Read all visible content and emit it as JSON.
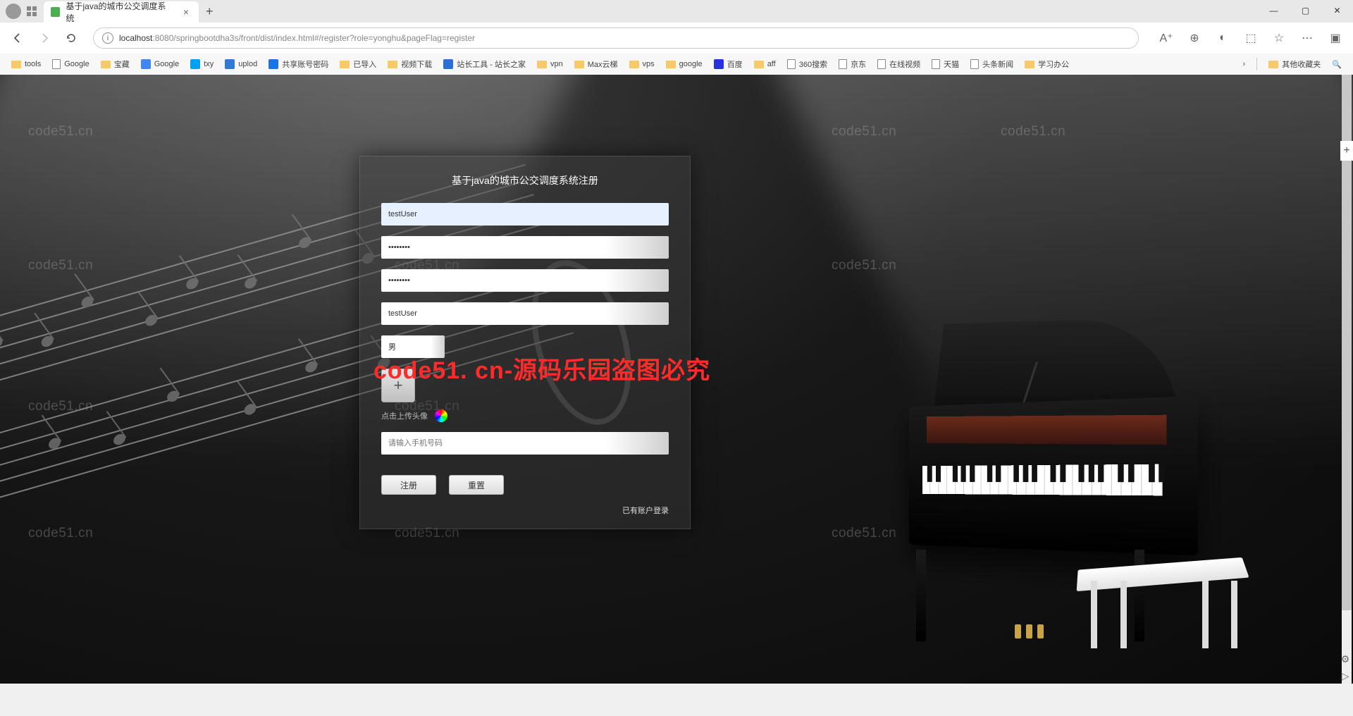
{
  "browser": {
    "tab_title": "基于java的城市公交调度系统",
    "url_host": "localhost",
    "url_path": ":8080/springbootdha3s/front/dist/index.html#/register?role=yonghu&pageFlag=register"
  },
  "bookmarks": {
    "items": [
      {
        "label": "tools",
        "type": "folder"
      },
      {
        "label": "Google",
        "type": "page"
      },
      {
        "label": "宝藏",
        "type": "folder"
      },
      {
        "label": "Google",
        "type": "icon",
        "color": "#4285f4"
      },
      {
        "label": "txy",
        "type": "icon",
        "color": "#00a1f1"
      },
      {
        "label": "uplod",
        "type": "icon",
        "color": "#2e7bd6"
      },
      {
        "label": "共享账号密码",
        "type": "icon",
        "color": "#1a73e8"
      },
      {
        "label": "已导入",
        "type": "folder"
      },
      {
        "label": "视频下载",
        "type": "folder"
      },
      {
        "label": "站长工具 - 站长之家",
        "type": "icon",
        "color": "#2a6fd6"
      },
      {
        "label": "vpn",
        "type": "folder"
      },
      {
        "label": "Max云梯",
        "type": "folder"
      },
      {
        "label": "vps",
        "type": "folder"
      },
      {
        "label": "google",
        "type": "folder"
      },
      {
        "label": "百度",
        "type": "icon",
        "color": "#2932e1"
      },
      {
        "label": "aff",
        "type": "folder"
      },
      {
        "label": "360搜索",
        "type": "page"
      },
      {
        "label": "京东",
        "type": "page"
      },
      {
        "label": "在线视频",
        "type": "page"
      },
      {
        "label": "天猫",
        "type": "page"
      },
      {
        "label": "头条新闻",
        "type": "page"
      },
      {
        "label": "学习办公",
        "type": "folder"
      }
    ],
    "other": "其他收藏夹"
  },
  "form": {
    "title": "基于java的城市公交调度系统注册",
    "username_value": "testUser",
    "password_value": "••••••••",
    "confirm_value": "••••••••",
    "nickname_value": "testUser",
    "gender_value": "男",
    "upload_hint": "点击上传头像",
    "phone_placeholder": "请输入手机号码",
    "register_btn": "注册",
    "reset_btn": "重置",
    "login_link": "已有账户登录"
  },
  "watermark": {
    "text": "code51.cn",
    "main": "code51. cn-源码乐园盗图必究"
  }
}
